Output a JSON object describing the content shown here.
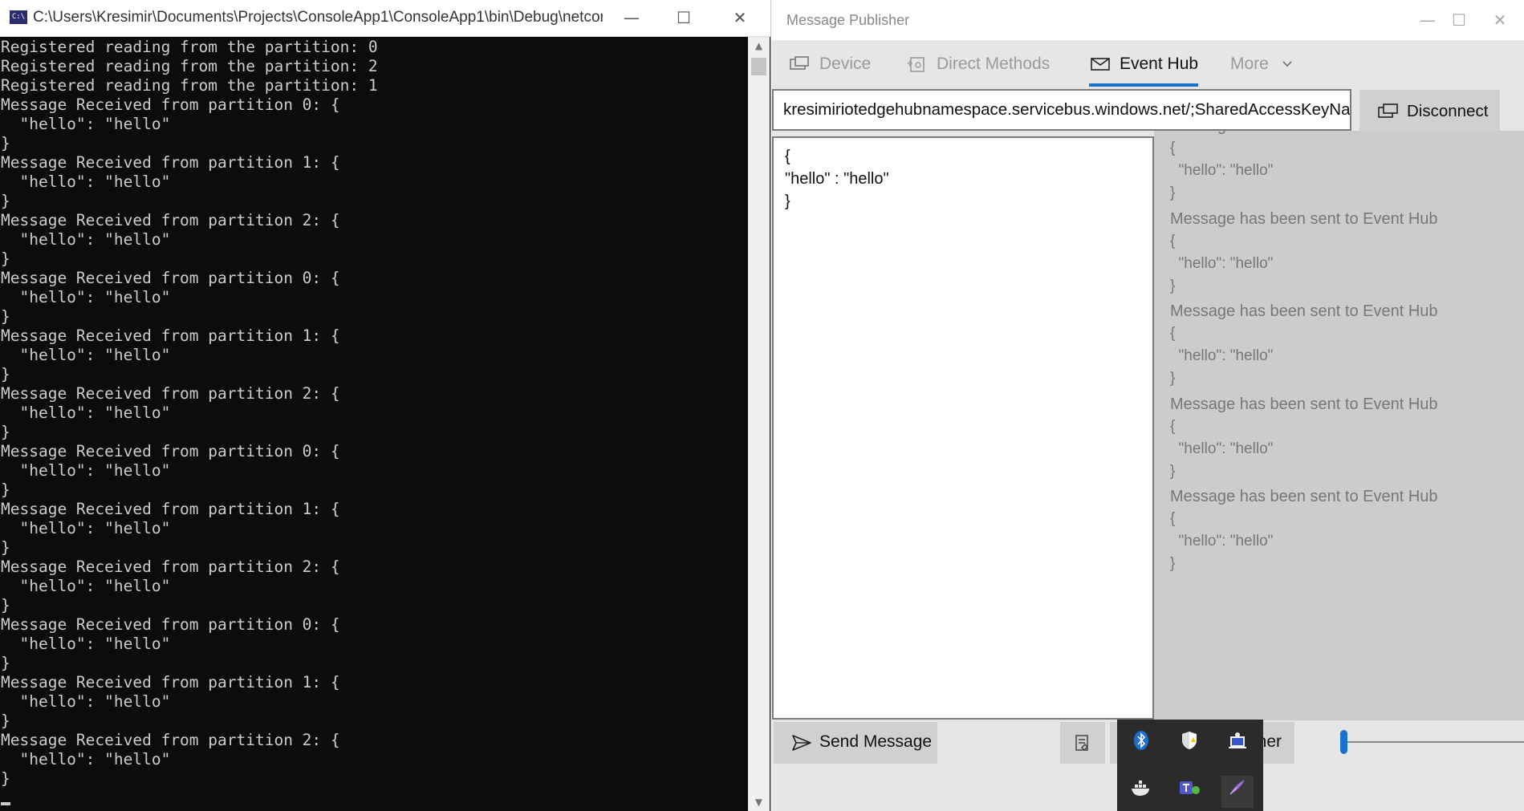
{
  "console": {
    "title": "C:\\Users\\Kresimir\\Documents\\Projects\\ConsoleApp1\\ConsoleApp1\\bin\\Debug\\netcore...",
    "icon": "C:\\",
    "lines": [
      "Registered reading from the partition: 0",
      "Registered reading from the partition: 2",
      "Registered reading from the partition: 1",
      "Message Received from partition 0: {",
      "  \"hello\": \"hello\"",
      "}",
      "Message Received from partition 1: {",
      "  \"hello\": \"hello\"",
      "}",
      "Message Received from partition 2: {",
      "  \"hello\": \"hello\"",
      "}",
      "Message Received from partition 0: {",
      "  \"hello\": \"hello\"",
      "}",
      "Message Received from partition 1: {",
      "  \"hello\": \"hello\"",
      "}",
      "Message Received from partition 2: {",
      "  \"hello\": \"hello\"",
      "}",
      "Message Received from partition 0: {",
      "  \"hello\": \"hello\"",
      "}",
      "Message Received from partition 1: {",
      "  \"hello\": \"hello\"",
      "}",
      "Message Received from partition 2: {",
      "  \"hello\": \"hello\"",
      "}",
      "Message Received from partition 0: {",
      "  \"hello\": \"hello\"",
      "}",
      "Message Received from partition 1: {",
      "  \"hello\": \"hello\"",
      "}",
      "Message Received from partition 2: {",
      "  \"hello\": \"hello\"",
      "}"
    ]
  },
  "window_controls": {
    "minimize": "—",
    "maximize": "☐",
    "close": "✕"
  },
  "publisher": {
    "title": "Message Publisher",
    "tabs": [
      {
        "label": "Device",
        "icon": "device-icon",
        "state": "disabled"
      },
      {
        "label": "Direct Methods",
        "icon": "direct-methods-icon",
        "state": "disabled"
      },
      {
        "label": "Event Hub",
        "icon": "event-hub-icon",
        "state": "active"
      },
      {
        "label": "More",
        "icon": "chevron-down-icon",
        "state": "disabled"
      }
    ],
    "connection_string": "kresimiriotedgehubnamespace.servicebus.windows.net/;SharedAccessKeyNa",
    "disconnect_label": "Disconnect",
    "message_text": "{\n\"hello\" : \"hello\"\n}",
    "log_entries": [
      {
        "head": "Message has been sent to Event Hub",
        "body": "{\n  \"hello\": \"hello\"\n}"
      },
      {
        "head": "Message has been sent to Event Hub",
        "body": "{\n  \"hello\": \"hello\"\n}"
      },
      {
        "head": "Message has been sent to Event Hub",
        "body": "{\n  \"hello\": \"hello\"\n}"
      },
      {
        "head": "Message has been sent to Event Hub",
        "body": "{\n  \"hello\": \"hello\"\n}"
      },
      {
        "head": "Message has been sent to Event Hub",
        "body": "{\n  \"hello\": \"hello\"\n}"
      }
    ],
    "send_label": "Send Message",
    "listen_label_visible": "ner",
    "slider_value": 0,
    "accent_color": "#1a73c9"
  },
  "tray": {
    "icons": [
      "bluetooth-icon",
      "security-shield-icon",
      "network-share-icon",
      "docker-icon",
      "teams-icon",
      "pen-icon"
    ]
  }
}
